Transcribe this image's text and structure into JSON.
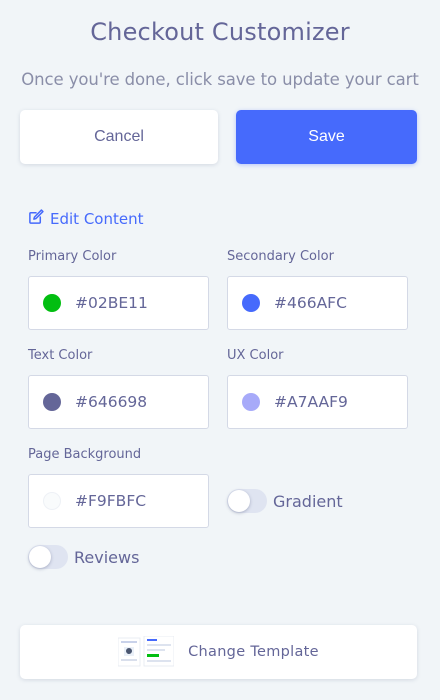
{
  "header": {
    "title": "Checkout Customizer",
    "subtitle": "Once you're done, click save to update your cart"
  },
  "actions": {
    "cancel_label": "Cancel",
    "save_label": "Save"
  },
  "edit_content": {
    "label": "Edit Content",
    "icon": "edit-icon"
  },
  "colors": {
    "primary": {
      "label": "Primary Color",
      "value": "#02BE11"
    },
    "secondary": {
      "label": "Secondary Color",
      "value": "#466AFC"
    },
    "text": {
      "label": "Text Color",
      "value": "#646698"
    },
    "ux": {
      "label": "UX Color",
      "value": "#A7AAF9"
    },
    "background": {
      "label": "Page Background",
      "value": "#F9FBFC"
    }
  },
  "toggles": {
    "gradient": {
      "label": "Gradient",
      "on": false
    },
    "reviews": {
      "label": "Reviews",
      "on": false
    }
  },
  "template": {
    "label": "Change Template",
    "thumbnail_icon": "template-thumbnail"
  }
}
